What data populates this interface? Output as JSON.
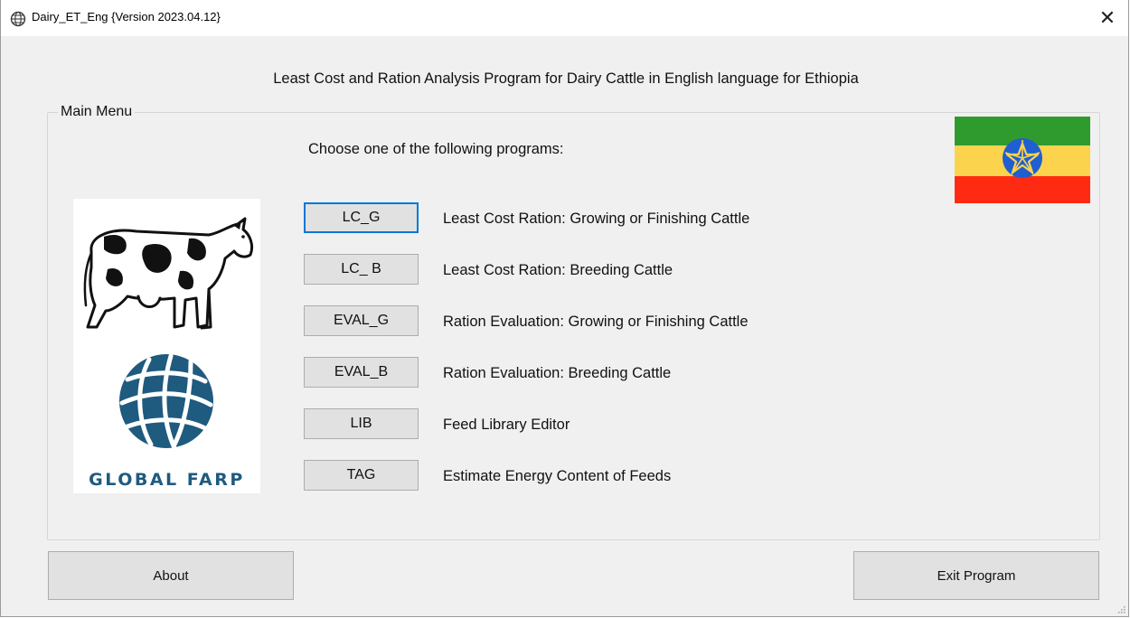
{
  "window": {
    "title": "Dairy_ET_Eng {Version 2023.04.12}",
    "close_glyph": "✕"
  },
  "header": {
    "text": "Least Cost and Ration Analysis Program for Dairy Cattle in English language for Ethiopia"
  },
  "main_menu": {
    "group_label": "Main Menu",
    "prompt": "Choose one of the following programs:",
    "programs": [
      {
        "button": "LC_G",
        "description": "Least Cost Ration: Growing or Finishing Cattle",
        "focused": true
      },
      {
        "button": "LC_ B",
        "description": "Least Cost Ration: Breeding Cattle"
      },
      {
        "button": "EVAL_G",
        "description": "Ration Evaluation: Growing or Finishing Cattle"
      },
      {
        "button": "EVAL_B",
        "description": "Ration Evaluation: Breeding Cattle"
      },
      {
        "button": "LIB",
        "description": "Feed Library Editor"
      },
      {
        "button": "TAG",
        "description": "Estimate Energy Content of Feeds"
      }
    ],
    "logo_text": "GLOBAL FARP"
  },
  "footer": {
    "about_label": "About",
    "exit_label": "Exit Program"
  },
  "icons": {
    "app": "globe-icon",
    "close": "close-icon",
    "flag": "ethiopia-flag-icon",
    "cow": "dairy-cow-icon",
    "logo": "global-farp-globe-icon"
  },
  "colors": {
    "flag_green": "#2f9b2f",
    "flag_yellow": "#fcd34d",
    "flag_red": "#ff2a12",
    "flag_emblem": "#1f5fd1",
    "logo_blue": "#1f5a7f",
    "focus_border": "#0078d7"
  }
}
